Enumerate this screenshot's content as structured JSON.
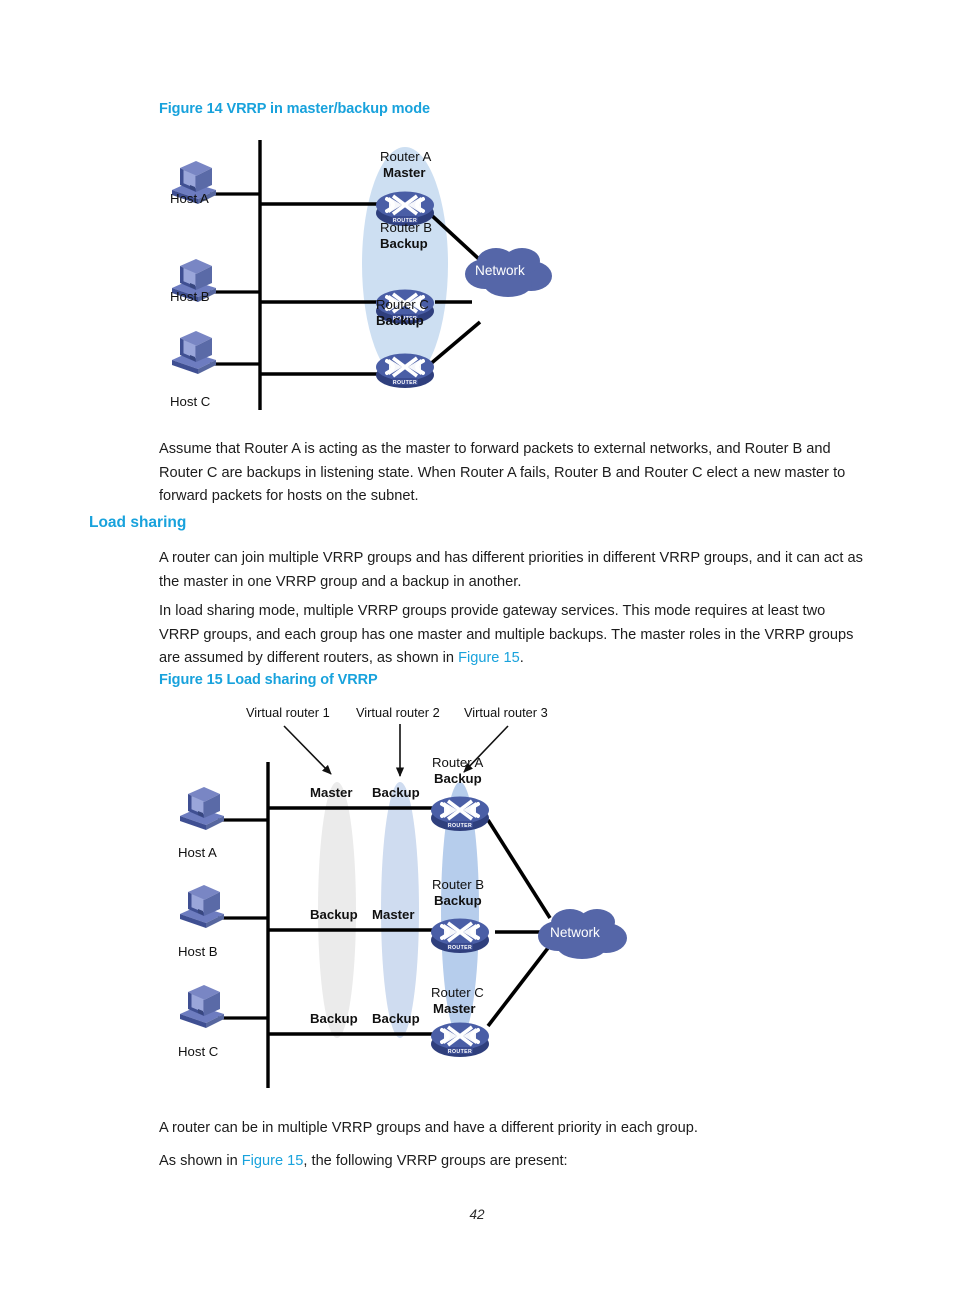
{
  "page": {
    "number": "42"
  },
  "figure14": {
    "caption": "Figure 14 VRRP in master/backup mode",
    "hosts": [
      {
        "label": "Host A"
      },
      {
        "label": "Host B"
      },
      {
        "label": "Host C"
      }
    ],
    "routers": [
      {
        "name": "Router A",
        "role": "Master"
      },
      {
        "name": "Router B",
        "role": "Backup"
      },
      {
        "name": "Router C",
        "role": "Backup"
      }
    ],
    "cloud": {
      "label": "Network"
    },
    "group_ellipse_color": "#cddff2"
  },
  "paragraphs": {
    "after_fig14": "Assume that Router A is acting as the master to forward packets to external networks, and Router B and Router C are backups in listening state. When Router A fails, Router B and Router C elect a new master to forward packets for hosts on the subnet.",
    "load_sharing_1": "A router can join multiple VRRP groups and has different priorities in different VRRP groups, and it can act as the master in one VRRP group and a backup in another.",
    "load_sharing_2_a": "In load sharing mode, multiple VRRP groups provide gateway services. This mode requires at least two VRRP groups, and each group has one master and multiple backups. The master roles in the VRRP groups are assumed by different routers, as shown in ",
    "load_sharing_2_xref": "Figure 15",
    "load_sharing_2_b": ".",
    "after_fig15_1": "A router can be in multiple VRRP groups and have a different priority in each group.",
    "after_fig15_2_a": "As shown in ",
    "after_fig15_2_xref": "Figure 15",
    "after_fig15_2_b": ", the following VRRP groups are present:"
  },
  "headings": {
    "load_sharing": "Load sharing"
  },
  "figure15": {
    "caption": "Figure 15 Load sharing of VRRP",
    "virtual_routers": [
      {
        "label": "Virtual router 1",
        "ellipse_color": "#ebebeb"
      },
      {
        "label": "Virtual router 2",
        "ellipse_color": "#cfdcf0"
      },
      {
        "label": "Virtual router 3",
        "ellipse_color": "#b6cdec"
      }
    ],
    "hosts": [
      {
        "label": "Host A"
      },
      {
        "label": "Host B"
      },
      {
        "label": "Host C"
      }
    ],
    "routers": [
      {
        "name": "Router A",
        "role": "Backup"
      },
      {
        "name": "Router B",
        "role": "Backup"
      },
      {
        "name": "Router C",
        "role": "Master"
      }
    ],
    "role_matrix": [
      [
        "Master",
        "Backup"
      ],
      [
        "Backup",
        "Master"
      ],
      [
        "Backup",
        "Backup"
      ]
    ],
    "cloud": {
      "label": "Network"
    }
  },
  "colors": {
    "accent_blue": "#18a2dc",
    "router_body": "#3a4e96",
    "router_top": "#4f63ab",
    "cloud": "#5566a8",
    "host_dark": "#3f4f92",
    "host_mid": "#6d7cc0",
    "host_screen": "#8e9ad2",
    "line": "#000000"
  }
}
